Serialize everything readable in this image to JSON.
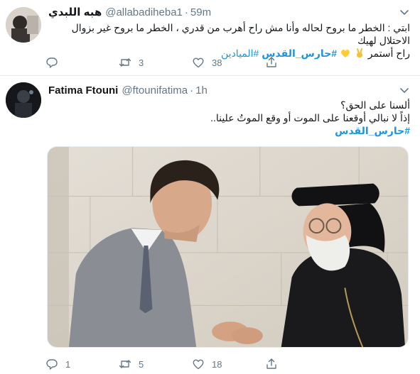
{
  "colors": {
    "accent": "#1b95e0",
    "muted": "#657786",
    "text": "#14171a",
    "divider": "#e6ecf0"
  },
  "tweets": [
    {
      "display_name": "هبه اللبدي",
      "handle": "@allabadiheba1",
      "separator": "·",
      "time": "59m",
      "text_line1": "ابتي : الخطر ما بروح لحاله وأنا مش راح أهرب من قدري ، الخطر ما بروح غير بزوال الاحتلال لهيك",
      "text_line2_start": "راح أستمر",
      "emojis": [
        "victory-hand-icon",
        "yellow-heart-icon"
      ],
      "hashtag1": "#حارس_القدس",
      "hashtag2": "#الميادين",
      "replies": "",
      "retweets": "3",
      "likes": "38"
    },
    {
      "display_name": "Fatima Ftouni",
      "handle": "@ftounifatima",
      "separator": "·",
      "time": "1h",
      "text_line1": "ألسنا على الحق؟",
      "text_line2": "إذاً لا نبالي أوقعنا على الموت أو وقع الموتُ علينا..",
      "hashtag": "#حارس_القدس",
      "replies": "1",
      "retweets": "5",
      "likes": "18"
    }
  ]
}
